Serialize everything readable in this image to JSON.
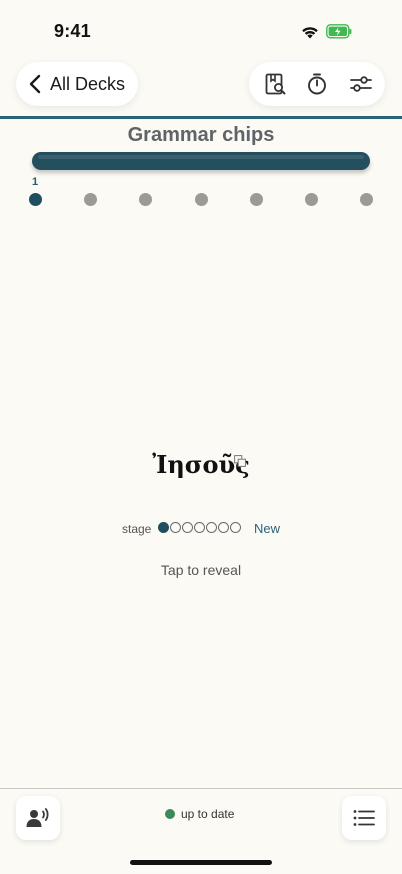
{
  "status_bar": {
    "time": "9:41"
  },
  "nav": {
    "back_label": "All Decks",
    "icons": [
      "bookmark-search-icon",
      "timer-icon",
      "sliders-icon"
    ]
  },
  "deck": {
    "title": "Grammar chips",
    "current_step": "1",
    "total_steps": 7,
    "progress": 1.0
  },
  "card": {
    "word": "Ἰησοῦς",
    "stage_label": "stage",
    "stage_level": 1,
    "stage_total": 7,
    "stage_status": "New",
    "reveal_hint": "Tap to reveal"
  },
  "footer": {
    "sync_status": "up to date",
    "colors": {
      "sync": "#3c8a5a",
      "accent": "#2b6478"
    }
  }
}
